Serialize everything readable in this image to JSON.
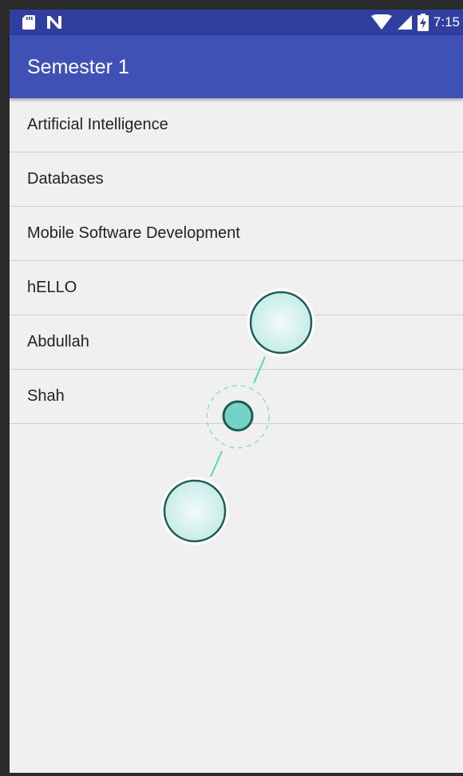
{
  "status_bar": {
    "time": "7:15",
    "icons": [
      "sd-card-icon",
      "n-notification-icon",
      "wifi-icon",
      "cell-signal-icon",
      "battery-icon"
    ]
  },
  "app_bar": {
    "title": "Semester 1"
  },
  "list": {
    "items": [
      {
        "label": "Artificial Intelligence"
      },
      {
        "label": "Databases"
      },
      {
        "label": "Mobile Software Development"
      },
      {
        "label": "hELLO"
      },
      {
        "label": "Abdullah"
      },
      {
        "label": "Shah"
      }
    ]
  },
  "colors": {
    "status_bar": "#303f9f",
    "app_bar": "#3f51b5",
    "background": "#f0f0f0",
    "gesture_fill": "#7dd3c8",
    "gesture_stroke": "#1f5a55"
  }
}
